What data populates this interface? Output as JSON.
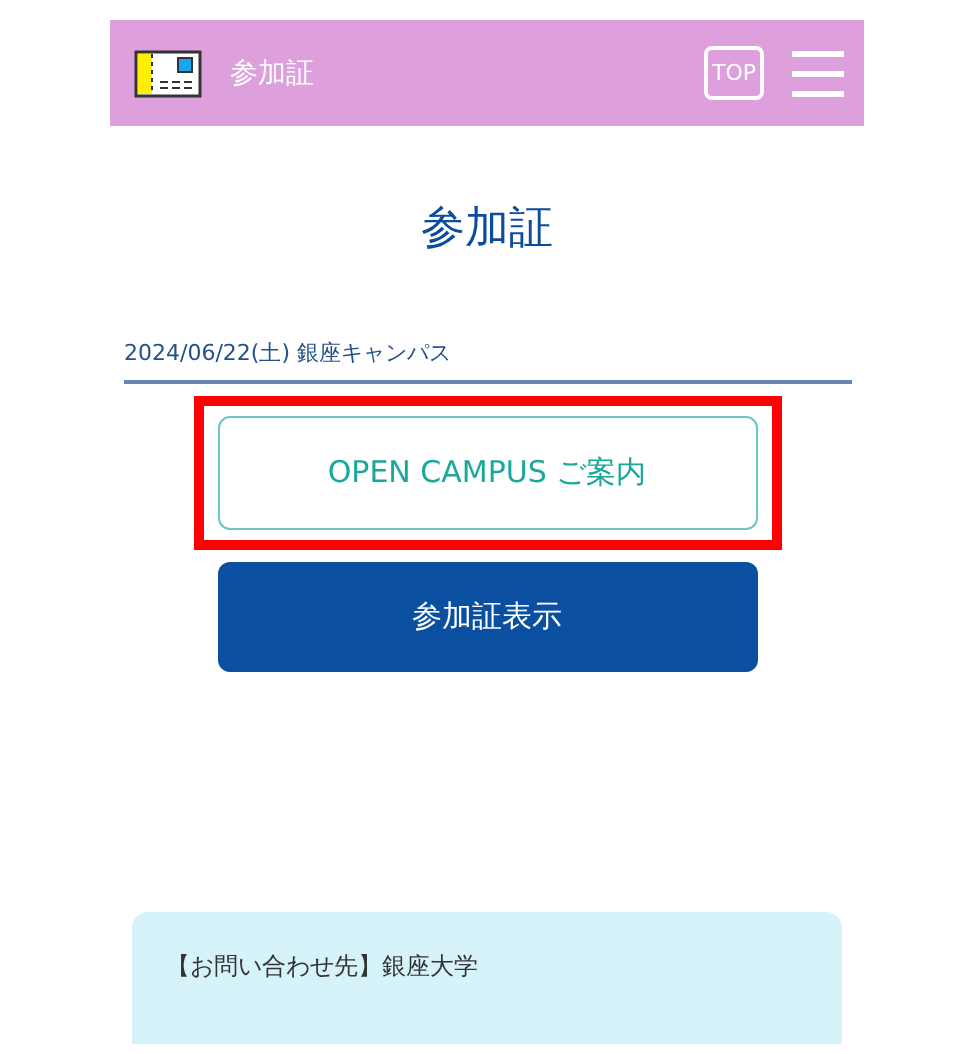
{
  "header": {
    "title": "参加証",
    "top_button": "TOP"
  },
  "page_title": "参加証",
  "event": {
    "date_place": "2024/06/22(土) 銀座キャンパス"
  },
  "buttons": [
    {
      "label": "OPEN CAMPUS ご案内",
      "kind": "outline",
      "highlighted": true
    },
    {
      "label": "参加証表示",
      "kind": "primary",
      "highlighted": false
    }
  ],
  "contact": {
    "text": "【お問い合わせ先】銀座大学"
  }
}
